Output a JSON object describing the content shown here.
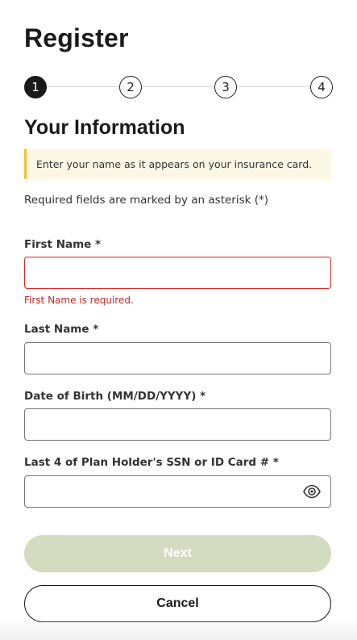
{
  "header": {
    "title": "Register"
  },
  "stepper": {
    "steps": [
      "1",
      "2",
      "3",
      "4"
    ],
    "current": "1"
  },
  "section": {
    "title": "Your Information",
    "notice": "Enter your name as it appears on your insurance card.",
    "required_note": "Required fields are marked by an asterisk (*)"
  },
  "form": {
    "first_name": {
      "label": "First Name *",
      "value": "",
      "error": "First Name is required."
    },
    "last_name": {
      "label": "Last Name *",
      "value": ""
    },
    "dob": {
      "label": "Date of Birth (MM/DD/YYYY) *",
      "value": ""
    },
    "ssn": {
      "label": "Last 4 of Plan Holder's SSN or ID Card # *",
      "value": "",
      "toggle_icon": "eye-icon"
    }
  },
  "actions": {
    "next_label": "Next",
    "cancel_label": "Cancel"
  },
  "colors": {
    "error": "#d42b2b",
    "notice_bg": "#fdf8e6",
    "notice_border": "#f2c230",
    "next_disabled": "#d3dcc0",
    "dark": "#1a1a1a"
  }
}
